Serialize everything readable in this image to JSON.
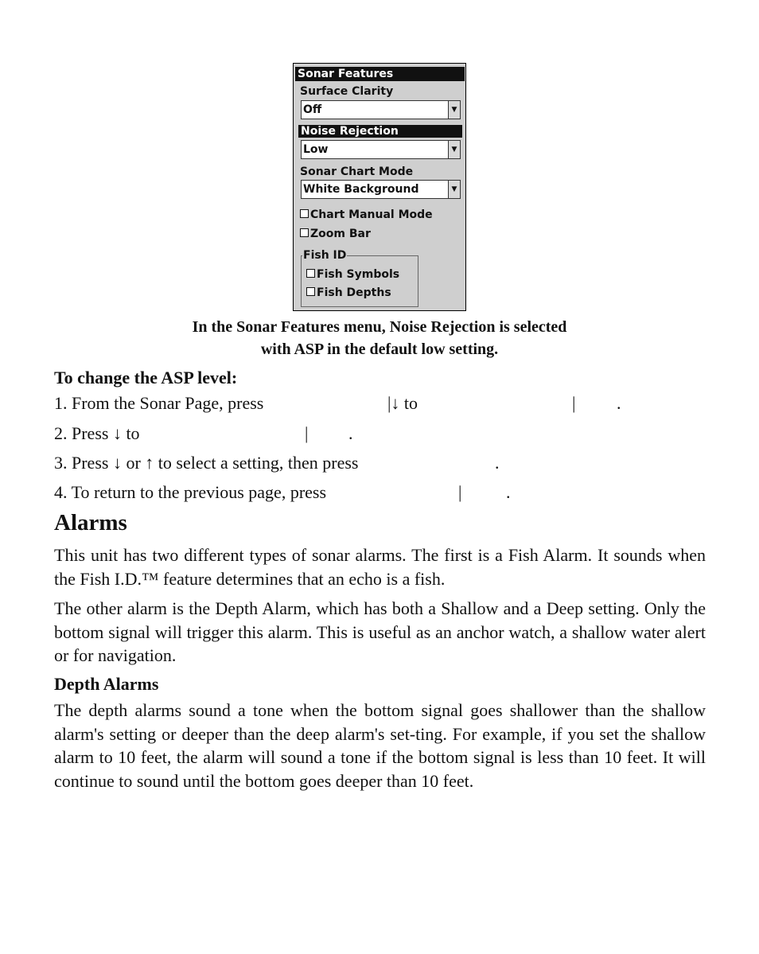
{
  "screenshot": {
    "title": "Sonar Features",
    "surface_clarity_label": "Surface Clarity",
    "surface_clarity_value": "Off",
    "noise_rejection_label": "Noise Rejection",
    "noise_rejection_value": "Low",
    "chart_mode_label": "Sonar Chart Mode",
    "chart_mode_value": "White Background",
    "chart_manual_mode": "Chart Manual Mode",
    "zoom_bar": "Zoom Bar",
    "fish_id_label": "Fish ID",
    "fish_symbols": "Fish Symbols",
    "fish_depths": "Fish Depths"
  },
  "caption": [
    "In the Sonar Features menu, Noise Rejection is selected",
    "with ASP in the default low setting."
  ],
  "steps_heading": "To change the ASP level:",
  "steps": {
    "s1": [
      "1. From the Sonar Page, press",
      "|↓ to",
      "|",
      "."
    ],
    "s2": [
      "2. Press ↓ to",
      "|",
      "."
    ],
    "s3": [
      "3. Press ↓ or ↑ to select a setting, then press",
      "."
    ],
    "s4": [
      "4. To return to the previous page, press",
      "|",
      "."
    ]
  },
  "alarms_heading": "Alarms",
  "p1": "This unit has two different types of sonar alarms. The first is a Fish Alarm. It sounds when the Fish I.D.™ feature determines that an echo is a fish.",
  "p2": "The other alarm is the Depth Alarm, which has both a Shallow and a Deep setting. Only the bottom signal will trigger this alarm. This is useful as an anchor watch, a shallow water alert or for navigation.",
  "depth_heading": "Depth Alarms",
  "p3": "The depth alarms sound a tone when the bottom signal goes shallower than the shallow alarm's setting or deeper than the deep alarm's set-ting. For example, if you set the shallow alarm to 10 feet, the alarm will sound a tone if the bottom signal is less than 10 feet. It will continue to sound until the bottom goes deeper than 10 feet."
}
